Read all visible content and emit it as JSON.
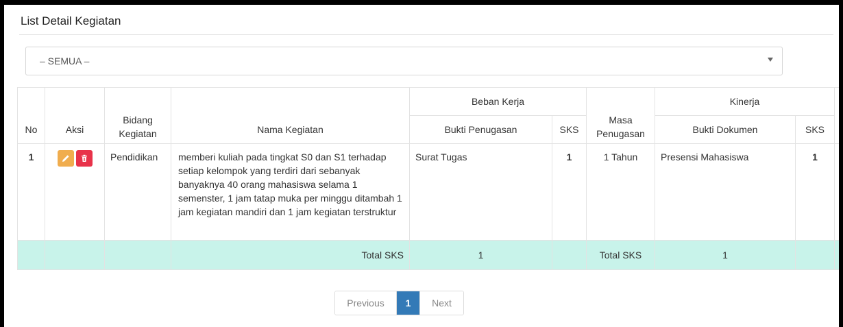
{
  "panel": {
    "title": "List Detail Kegiatan"
  },
  "filter": {
    "selected": "– SEMUA –"
  },
  "table": {
    "headers": {
      "no": "No",
      "aksi": "Aksi",
      "bidang_line1": "Bidang",
      "bidang_line2": "Kegiatan",
      "nama": "Nama Kegiatan",
      "beban_kerja": "Beban Kerja",
      "bukti_penugasan": "Bukti Penugasan",
      "sks1": "SKS",
      "masa_line1": "Masa",
      "masa_line2": "Penugasan",
      "kinerja": "Kinerja",
      "bukti_dokumen": "Bukti Dokumen",
      "sks2": "SKS"
    },
    "rows": [
      {
        "no": "1",
        "bidang": "Pendidikan",
        "nama": "memberi kuliah pada tingkat S0 dan S1 terhadap setiap kelompok yang terdiri dari sebanyak banyaknya 40 orang mahasiswa selama 1 semenster, 1 jam tatap muka per minggu ditambah 1 jam kegiatan mandiri dan 1 jam kegiatan terstruktur",
        "bukti_penugasan": "Surat Tugas",
        "sks_beban": "1",
        "masa": "1 Tahun",
        "bukti_dokumen": "Presensi Mahasiswa",
        "sks_kinerja": "1"
      }
    ],
    "total": {
      "label1": "Total SKS",
      "value1": "1",
      "label2": "Total SKS",
      "value2": "1"
    }
  },
  "pagination": {
    "previous": "Previous",
    "current": "1",
    "next": "Next"
  },
  "colors": {
    "total_row": "#c8f3ea",
    "edit": "#f0ad4e",
    "delete": "#e8324a",
    "active_page": "#337ab7"
  },
  "icons": {
    "edit": "pencil-icon",
    "delete": "trash-icon",
    "select": "caret-down-icon"
  }
}
